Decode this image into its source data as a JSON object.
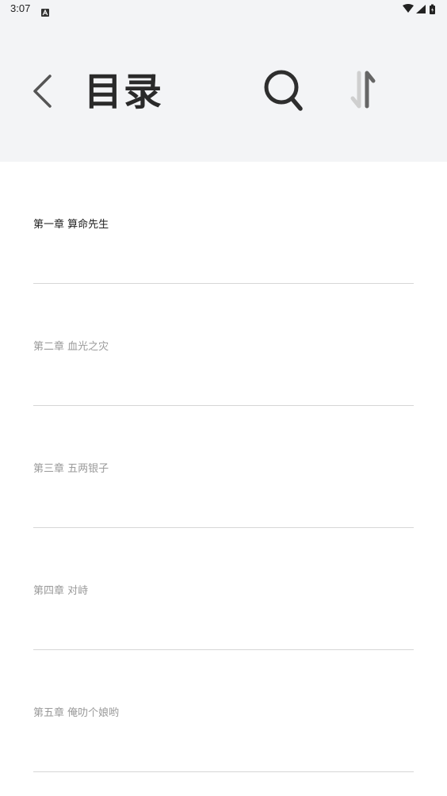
{
  "status_bar": {
    "time": "3:07",
    "icons": [
      "notification-a-icon",
      "wifi-icon",
      "cellular-icon",
      "battery-icon"
    ]
  },
  "header": {
    "back_icon": "chevron-left-icon",
    "title": "目录",
    "search_icon": "search-icon",
    "sort_icon": "sort-arrows-icon"
  },
  "chapters": [
    {
      "title": "第一章 算命先生",
      "active": true
    },
    {
      "title": "第二章 血光之灾",
      "active": false
    },
    {
      "title": "第三章 五两银子",
      "active": false
    },
    {
      "title": "第四章 对峙",
      "active": false
    },
    {
      "title": "第五章 俺叻个娘哟",
      "active": false
    }
  ],
  "colors": {
    "header_bg": "#f3f4f6",
    "title_text": "#2a2a2a",
    "active_text": "#222222",
    "inactive_text": "#9a9a9a",
    "divider": "#d6d6d6"
  }
}
